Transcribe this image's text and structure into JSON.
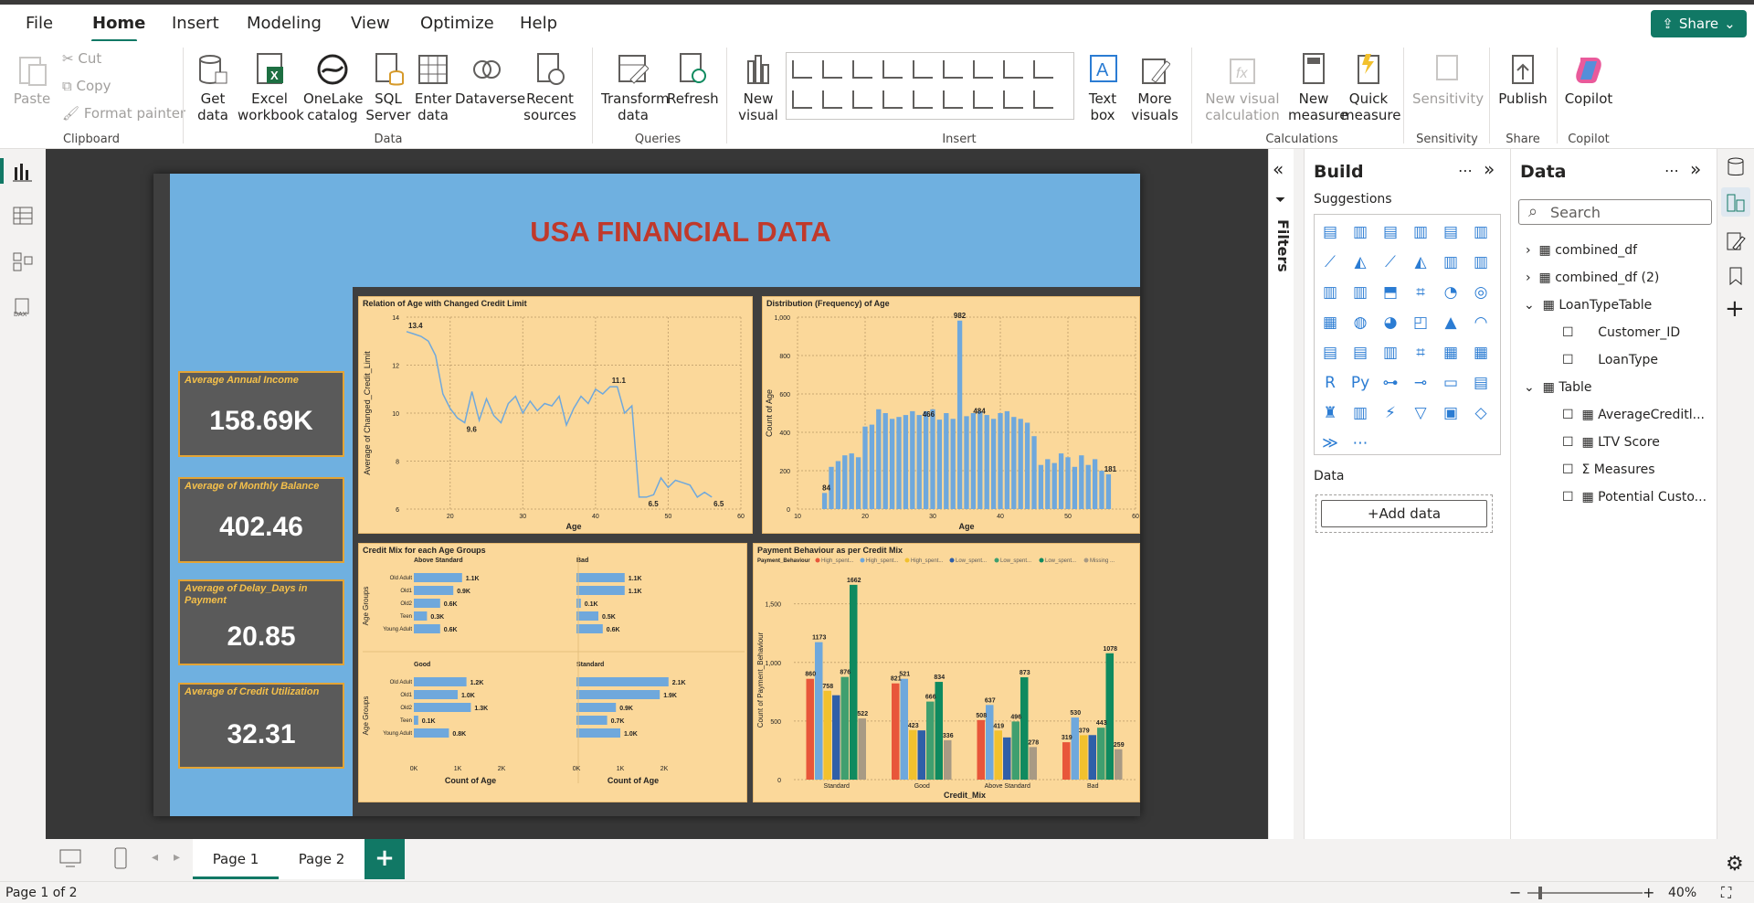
{
  "menu": {
    "items": [
      "File",
      "Home",
      "Insert",
      "Modeling",
      "View",
      "Optimize",
      "Help"
    ],
    "active": "Home",
    "share": "Share"
  },
  "ribbon": {
    "clipboard": {
      "paste": "Paste",
      "cut": "Cut",
      "copy": "Copy",
      "format_painter": "Format painter",
      "group": "Clipboard"
    },
    "data": {
      "get_data": "Get data",
      "excel": "Excel workbook",
      "onelake": "OneLake catalog",
      "sql": "SQL Server",
      "enter": "Enter data",
      "dataverse": "Dataverse",
      "recent": "Recent sources",
      "group": "Data"
    },
    "queries": {
      "transform": "Transform data",
      "refresh": "Refresh",
      "group": "Queries"
    },
    "insert": {
      "new_visual": "New visual",
      "text_box": "Text box",
      "more_visuals": "More visuals",
      "group": "Insert"
    },
    "calculations": {
      "new_visual_calc": "New visual calculation",
      "new_measure": "New measure",
      "quick_measure": "Quick measure",
      "group": "Calculations"
    },
    "sensitivity": {
      "label": "Sensitivity",
      "group": "Sensitivity"
    },
    "share": {
      "publish": "Publish",
      "group": "Share"
    },
    "copilot": {
      "label": "Copilot",
      "group": "Copilot"
    }
  },
  "report": {
    "title": "USA FINANCIAL DATA",
    "cards": [
      {
        "label": "Average Annual Income",
        "value": "158.69K"
      },
      {
        "label": "Average of Monthly Balance",
        "value": "402.46"
      },
      {
        "label": "Average of Delay_Days in Payment",
        "value": "20.85"
      },
      {
        "label": "Average of Credit Utilization",
        "value": "32.31"
      }
    ]
  },
  "chart_data": [
    {
      "type": "line",
      "title": "Relation of Age with Changed Credit Limit",
      "xlabel": "Age",
      "ylabel": "Average of Changed_Credit_Limit",
      "xlim": [
        14,
        60
      ],
      "ylim": [
        6,
        14
      ],
      "x_ticks": [
        "20",
        "30",
        "40",
        "50",
        "60"
      ],
      "y_ticks": [
        "14",
        "12",
        "10",
        "8",
        "6"
      ],
      "x": [
        14,
        15,
        16,
        17,
        18,
        19,
        20,
        21,
        22,
        23,
        24,
        25,
        26,
        27,
        28,
        29,
        30,
        31,
        32,
        33,
        34,
        35,
        36,
        37,
        38,
        39,
        40,
        41,
        42,
        43,
        44,
        45,
        46,
        47,
        48,
        49,
        50,
        51,
        52,
        53,
        54,
        55,
        56
      ],
      "y": [
        13.4,
        13.3,
        13.2,
        13.0,
        12.4,
        10.8,
        10.2,
        9.8,
        9.6,
        10.9,
        9.7,
        10.6,
        9.9,
        9.6,
        10.4,
        10.7,
        10.0,
        10.5,
        10.1,
        10.4,
        10.3,
        10.7,
        9.5,
        10.2,
        10.7,
        10.4,
        11.0,
        10.8,
        11.1,
        11.1,
        10.0,
        10.3,
        6.5,
        6.5,
        6.6,
        7.3,
        6.9,
        7.2,
        7.1,
        7.0,
        6.5,
        6.7,
        6.5
      ],
      "data_labels": [
        "13.4",
        "9.6",
        "11.1",
        "6.5",
        "6.5"
      ]
    },
    {
      "type": "bar",
      "title": "Distribution (Frequency) of Age",
      "xlabel": "Age",
      "ylabel": "Count of Age",
      "xlim": [
        10,
        60
      ],
      "ylim": [
        0,
        1000
      ],
      "x_ticks": [
        "10",
        "20",
        "30",
        "40",
        "50",
        "60"
      ],
      "y_ticks": [
        "1,000",
        "800",
        "600",
        "400",
        "200",
        "0"
      ],
      "categories": [
        "14",
        "15",
        "16",
        "17",
        "18",
        "19",
        "20",
        "21",
        "22",
        "23",
        "24",
        "25",
        "26",
        "27",
        "28",
        "29",
        "30",
        "31",
        "32",
        "33",
        "34",
        "35",
        "36",
        "37",
        "38",
        "39",
        "40",
        "41",
        "42",
        "43",
        "44",
        "45",
        "46",
        "47",
        "48",
        "49",
        "50",
        "51",
        "52",
        "53",
        "54",
        "55",
        "56"
      ],
      "values": [
        84,
        220,
        250,
        280,
        290,
        270,
        430,
        440,
        520,
        500,
        470,
        480,
        490,
        510,
        490,
        510,
        520,
        466,
        500,
        470,
        982,
        484,
        500,
        510,
        490,
        470,
        500,
        510,
        480,
        470,
        450,
        380,
        230,
        260,
        240,
        290,
        270,
        220,
        280,
        230,
        260,
        200,
        181
      ],
      "data_labels": [
        "84",
        "466",
        "982",
        "484",
        "181"
      ]
    },
    {
      "type": "bar",
      "orientation": "horizontal",
      "title": "Credit Mix for each Age Groups",
      "xlabel": "Count of Age",
      "ylabel": "Age Groups",
      "x_ticks": [
        "0K",
        "1K",
        "2K"
      ],
      "categories": [
        "Old Adult",
        "Old1",
        "Old2",
        "Teen",
        "Young Adult"
      ],
      "panels": [
        {
          "name": "Above Standard",
          "values": [
            1.1,
            0.9,
            0.6,
            0.3,
            0.6
          ],
          "labels": [
            "1.1K",
            "0.9K",
            "0.6K",
            "0.3K",
            "0.6K"
          ]
        },
        {
          "name": "Bad",
          "values": [
            1.1,
            1.1,
            0.1,
            0.5,
            0.6
          ],
          "labels": [
            "1.1K",
            "1.1K",
            "0.1K",
            "0.5K",
            "0.6K"
          ]
        },
        {
          "name": "Good",
          "values": [
            1.2,
            1.0,
            1.3,
            0.1,
            0.8
          ],
          "labels": [
            "1.2K",
            "1.0K",
            "1.3K",
            "0.1K",
            "0.8K"
          ]
        },
        {
          "name": "Standard",
          "values": [
            2.1,
            1.9,
            0.9,
            0.7,
            1.0
          ],
          "labels": [
            "2.1K",
            "1.9K",
            "0.9K",
            "0.7K",
            "1.0K"
          ]
        }
      ]
    },
    {
      "type": "bar",
      "title": "Payment Behaviour as per Credit Mix",
      "xlabel": "Credit_Mix",
      "ylabel": "Count of Payment_Behaviour",
      "legend_title": "Payment_Behaviour",
      "legend": [
        "High_spent...",
        "High_spent...",
        "High_spent...",
        "Low_spent...",
        "Low_spent...",
        "Low_spent...",
        "Missing ..."
      ],
      "colors": [
        "#e8563a",
        "#6fa8dc",
        "#f2c12e",
        "#2f5fa8",
        "#3f9f6f",
        "#0f8a5f",
        "#a89a84"
      ],
      "ylim": [
        0,
        1700
      ],
      "y_ticks": [
        "1,500",
        "1,000",
        "500",
        "0"
      ],
      "categories": [
        "Standard",
        "Good",
        "Above Standard",
        "Bad"
      ],
      "series": [
        {
          "values": [
            860,
            821,
            508,
            319
          ]
        },
        {
          "values": [
            1173,
            860,
            637,
            530
          ]
        },
        {
          "values": [
            758,
            423,
            419,
            379
          ]
        },
        {
          "values": [
            720,
            420,
            360,
            380
          ]
        },
        {
          "values": [
            876,
            666,
            496,
            443
          ]
        },
        {
          "values": [
            1662,
            834,
            873,
            1078
          ]
        },
        {
          "values": [
            522,
            336,
            278,
            259
          ]
        }
      ],
      "data_labels": [
        [
          "860",
          "1173",
          "758",
          "876",
          "1662",
          "522"
        ],
        [
          "821",
          "521",
          "423",
          "666",
          "834",
          "336"
        ],
        [
          "508",
          "637",
          "419",
          "496",
          "873",
          "278"
        ],
        [
          "319",
          "530",
          "379",
          "443",
          "1078",
          "259"
        ]
      ]
    }
  ],
  "build_pane": {
    "title": "Build",
    "suggestions": "Suggestions",
    "data_label": "Data",
    "add_data": "+Add data"
  },
  "data_pane": {
    "title": "Data",
    "search_placeholder": "Search",
    "tables": [
      "combined_df",
      "combined_df (2)",
      "LoanTypeTable",
      "Customer_ID",
      "LoanType",
      "Table",
      "AverageCreditl...",
      "LTV Score",
      "Measures",
      "Potential Custo..."
    ]
  },
  "filters_label": "Filters",
  "pages": [
    "Page 1",
    "Page 2"
  ],
  "status": {
    "page_info": "Page 1 of 2",
    "zoom": "40%"
  }
}
